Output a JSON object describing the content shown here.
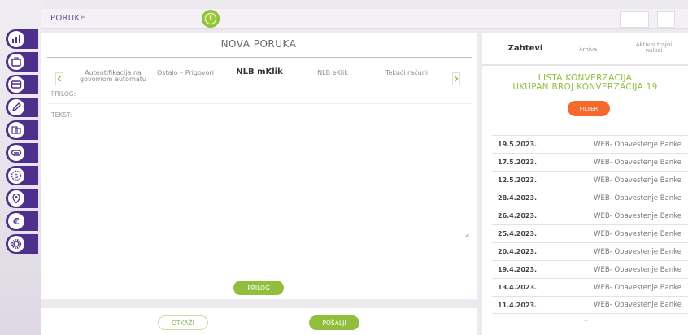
{
  "topbar": {
    "title": "PORUKE",
    "info_icon": "info-icon"
  },
  "compose": {
    "title": "NOVA PORUKA",
    "tabs": [
      {
        "label": "Autentifikacija na govornom automatu",
        "active": false
      },
      {
        "label": "Ostalo – Prigovori",
        "active": false
      },
      {
        "label": "NLB mKlik",
        "active": true
      },
      {
        "label": "NLB eKlik",
        "active": false
      },
      {
        "label": "Tekući računi",
        "active": false
      }
    ],
    "attachment_label": "PRILOG:",
    "text_label": "TEKST:",
    "attach_button": "PRILOG"
  },
  "actions": {
    "cancel_label": "OTKAŽI",
    "send_label": "POŠALJI"
  },
  "sidebar": {
    "icons": [
      "bar-chart-icon",
      "briefcase-icon",
      "card-icon",
      "edit-icon",
      "transfer-icon",
      "minus-card-icon",
      "dollar-icon",
      "location-pin-icon",
      "euro-icon",
      "gear-icon"
    ]
  },
  "conversations": {
    "tabs": [
      {
        "label": "Zahtevi",
        "active": true
      },
      {
        "label": "Arhiva",
        "active": false
      },
      {
        "label": "Aktivni trajni nalozi",
        "active": false
      }
    ],
    "list_title": "LISTA KONVERZACIJA",
    "count_text": "UKUPAN BROJ KONVERZACIJA 19",
    "filter_label": "FILTER",
    "rows": [
      {
        "date": "19.5.2023.",
        "type": "WEB- Obavestenje Banke"
      },
      {
        "date": "17.5.2023.",
        "type": "WEB- Obavestenje Banke"
      },
      {
        "date": "12.5.2023.",
        "type": "WEB- Obavestenje Banke"
      },
      {
        "date": "28.4.2023.",
        "type": "WEB- Obavestenje Banke"
      },
      {
        "date": "26.4.2023.",
        "type": "WEB- Obavestenje Banke"
      },
      {
        "date": "25.4.2023.",
        "type": "WEB- Obavestenje Banke"
      },
      {
        "date": "20.4.2023.",
        "type": "WEB- Obavestenje Banke"
      },
      {
        "date": "19.4.2023.",
        "type": "WEB- Obavestenje Banke"
      },
      {
        "date": "13.4.2023.",
        "type": "WEB- Obavestenje Banke"
      },
      {
        "date": "11.4.2023.",
        "type": "WEB- Obavestenje Banke"
      }
    ]
  },
  "colors": {
    "sidebar": "#4e2f8c",
    "accent_green": "#8fbf3c",
    "filter_orange": "#f36a2c"
  }
}
